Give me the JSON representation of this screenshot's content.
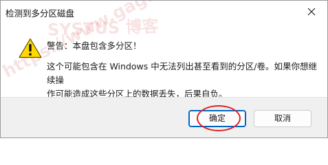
{
  "window": {
    "title": "检测到多分区磁盘",
    "close_icon": "close-icon"
  },
  "content": {
    "icon": "warning-triangle-icon",
    "heading": "警告：本盘包含多分区！",
    "message_line1": "这个可能包含在 Windows 中无法列出甚至看到的分区/卷。如果你想继续操",
    "message_line2": "作可能造成这些分区上的数据丢失，后果自负。"
  },
  "buttons": {
    "ok_label": "确定",
    "cancel_label": "取消"
  },
  "watermark": {
    "text1": "SYSTUS 博客",
    "text2": "https://www.gagas.com"
  },
  "colors": {
    "accent": "#0067c0",
    "footer_bg": "#f0f0f0",
    "warning_fill": "#ffd800",
    "annotation": "#e02020",
    "watermark": "#c82828"
  }
}
